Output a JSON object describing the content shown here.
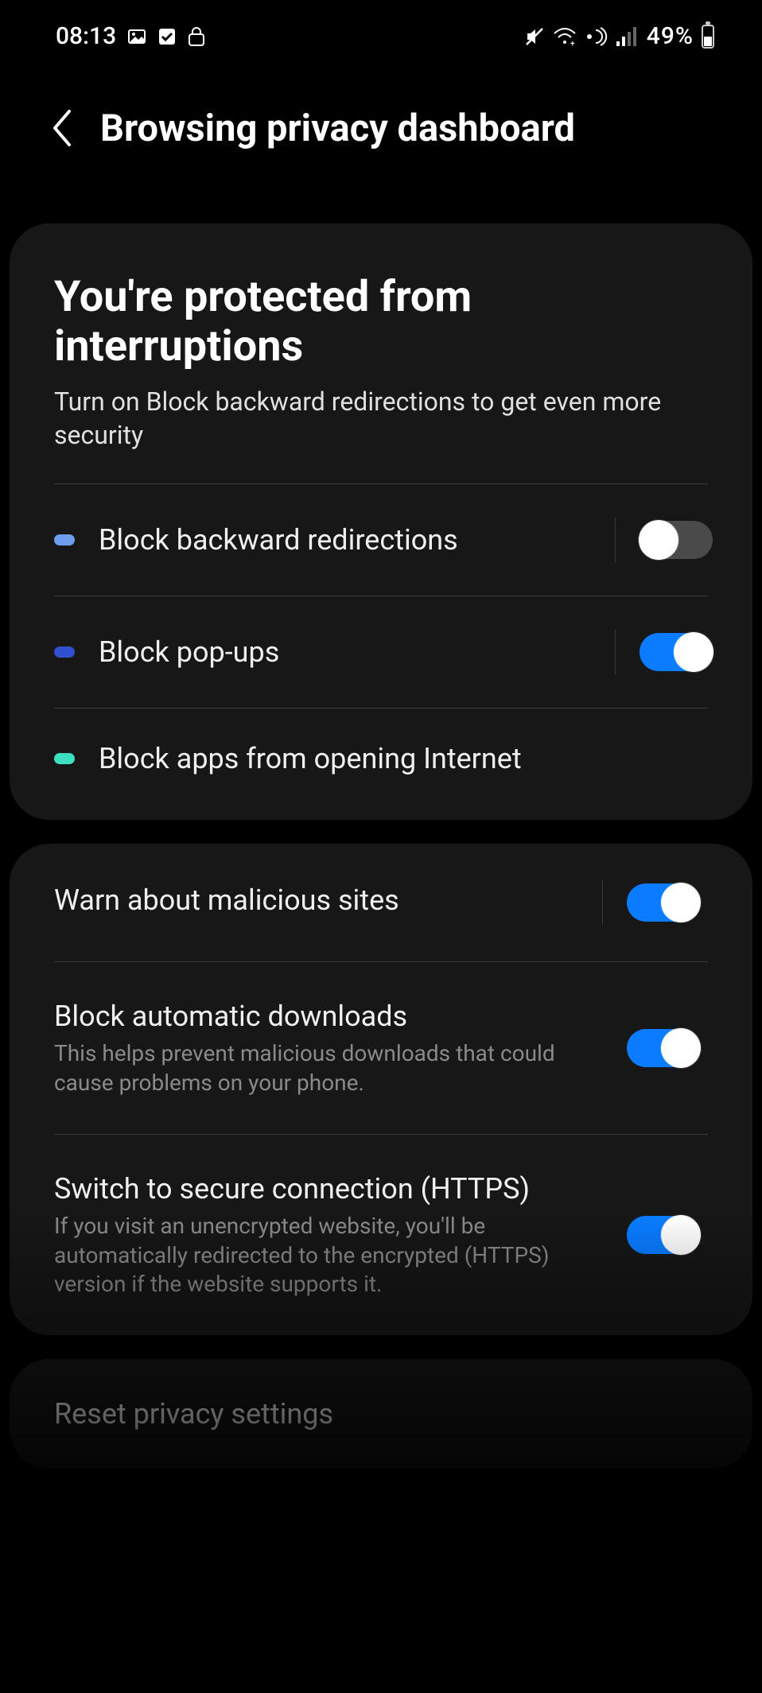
{
  "status": {
    "time": "08:13",
    "battery_percent": "49%"
  },
  "header": {
    "title": "Browsing privacy dashboard"
  },
  "hero": {
    "title": "You're protected from interruptions",
    "subtitle": "Turn on Block backward redirections to get even more security"
  },
  "protection_rows": [
    {
      "label": "Block backward redirections",
      "pill": "lightblue",
      "toggle": "off"
    },
    {
      "label": "Block pop-ups",
      "pill": "blue",
      "toggle": "on"
    },
    {
      "label": "Block apps from opening Internet",
      "pill": "teal",
      "toggle": null
    }
  ],
  "security_rows": [
    {
      "title": "Warn about malicious sites",
      "desc": "",
      "toggle": "on",
      "vsep": true
    },
    {
      "title": "Block automatic downloads",
      "desc": "This helps prevent malicious downloads that could cause problems on your phone.",
      "toggle": "on",
      "vsep": false
    },
    {
      "title": "Switch to secure connection (HTTPS)",
      "desc": "If you visit an unencrypted website, you'll be automatically redirected to the encrypted (HTTPS) version if the website supports it.",
      "toggle": "on",
      "vsep": false
    }
  ],
  "reset": {
    "label": "Reset privacy settings"
  }
}
